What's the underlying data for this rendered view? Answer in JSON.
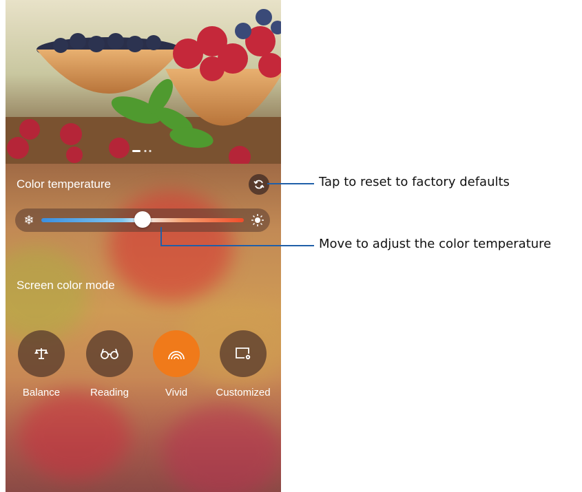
{
  "color_temperature": {
    "label": "Color temperature",
    "slider_value_fraction": 0.5,
    "cold_icon": "snowflake-icon",
    "warm_icon": "sun-icon"
  },
  "screen_color_mode": {
    "label": "Screen color mode",
    "modes": [
      {
        "label": "Balance",
        "icon": "balance-scale-icon",
        "active": false
      },
      {
        "label": "Reading",
        "icon": "glasses-icon",
        "active": false
      },
      {
        "label": "Vivid",
        "icon": "vivid-waves-icon",
        "active": true
      },
      {
        "label": "Customized",
        "icon": "custom-screen-icon",
        "active": false
      }
    ]
  },
  "callouts": {
    "reset": "Tap to reset to factory defaults",
    "adjust": "Move to adjust the color temperature"
  },
  "colors": {
    "accent": "#f07a1a",
    "callout_line": "#1f5fa8"
  }
}
